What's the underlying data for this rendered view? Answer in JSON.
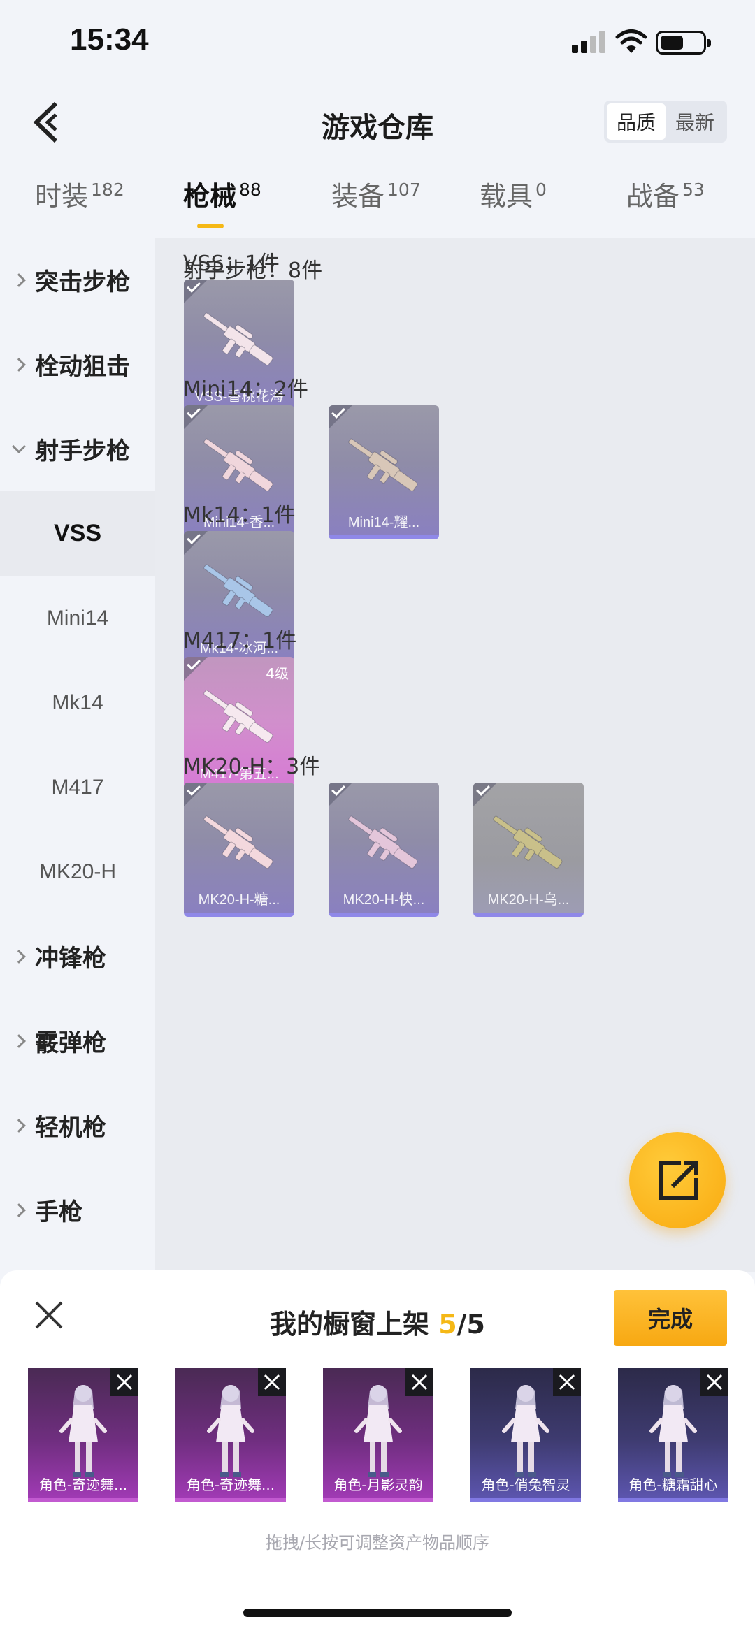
{
  "status_bar": {
    "time": "15:34",
    "battery_level": 0.55
  },
  "header": {
    "title": "游戏仓库",
    "sort_options": [
      "品质",
      "最新"
    ],
    "sort_selected": "品质"
  },
  "tabs": [
    {
      "label": "时装",
      "count": "182"
    },
    {
      "label": "枪械",
      "count": "88",
      "active": true
    },
    {
      "label": "装备",
      "count": "107"
    },
    {
      "label": "载具",
      "count": "0"
    },
    {
      "label": "战备",
      "count": "53"
    }
  ],
  "sidebar": {
    "items": [
      {
        "label": "突击步枪",
        "type": "category",
        "expanded": false
      },
      {
        "label": "栓动狙击",
        "type": "category",
        "expanded": false
      },
      {
        "label": "射手步枪",
        "type": "category",
        "expanded": true
      },
      {
        "label": "VSS",
        "type": "sub",
        "selected": true
      },
      {
        "label": "Mini14",
        "type": "sub"
      },
      {
        "label": "Mk14",
        "type": "sub"
      },
      {
        "label": "M417",
        "type": "sub"
      },
      {
        "label": "MK20-H",
        "type": "sub"
      },
      {
        "label": "冲锋枪",
        "type": "category",
        "expanded": false
      },
      {
        "label": "霰弹枪",
        "type": "category",
        "expanded": false
      },
      {
        "label": "轻机枪",
        "type": "category",
        "expanded": false
      },
      {
        "label": "手枪",
        "type": "category",
        "expanded": false
      }
    ]
  },
  "content": {
    "category_header": "射手步枪：8件",
    "sections": [
      {
        "label": "VSS：1件",
        "items": [
          {
            "name": "VSS-香桃花海",
            "style": "purple",
            "gun_color": "#f3e4ea"
          }
        ]
      },
      {
        "label": "Mini14：2件",
        "items": [
          {
            "name": "Mini14-香...",
            "style": "purple",
            "gun_color": "#f0d6dc"
          },
          {
            "name": "Mini14-耀...",
            "style": "purple",
            "gun_color": "#d8c7b8"
          }
        ]
      },
      {
        "label": "Mk14：1件",
        "items": [
          {
            "name": "Mk14-冰河...",
            "style": "purple",
            "gun_color": "#a9c6e8"
          }
        ]
      },
      {
        "label": "M417：1件",
        "items": [
          {
            "name": "M417-第五...",
            "style": "pink",
            "gun_color": "#f6e9ef",
            "level": "4级"
          }
        ]
      },
      {
        "label": "MK20-H：3件",
        "items": [
          {
            "name": "MK20-H-糖...",
            "style": "purple",
            "gun_color": "#f3d8dd"
          },
          {
            "name": "MK20-H-快...",
            "style": "purple",
            "gun_color": "#e4c6da"
          },
          {
            "name": "MK20-H-乌...",
            "style": "gray",
            "gun_color": "#c9c08a"
          }
        ]
      }
    ]
  },
  "share_button": {
    "icon": "share-icon"
  },
  "showcase": {
    "title_prefix": "我的橱窗上架 ",
    "count": "5",
    "total": "/5",
    "done_label": "完成",
    "hint": "拖拽/长按可调整资产物品顺序",
    "items": [
      {
        "name": "角色-奇迹舞...",
        "style": "magenta"
      },
      {
        "name": "角色-奇迹舞...",
        "style": "magenta"
      },
      {
        "name": "角色-月影灵韵",
        "style": "magenta"
      },
      {
        "name": "角色-俏兔智灵",
        "style": "blue"
      },
      {
        "name": "角色-糖霜甜心",
        "style": "blue"
      }
    ]
  }
}
